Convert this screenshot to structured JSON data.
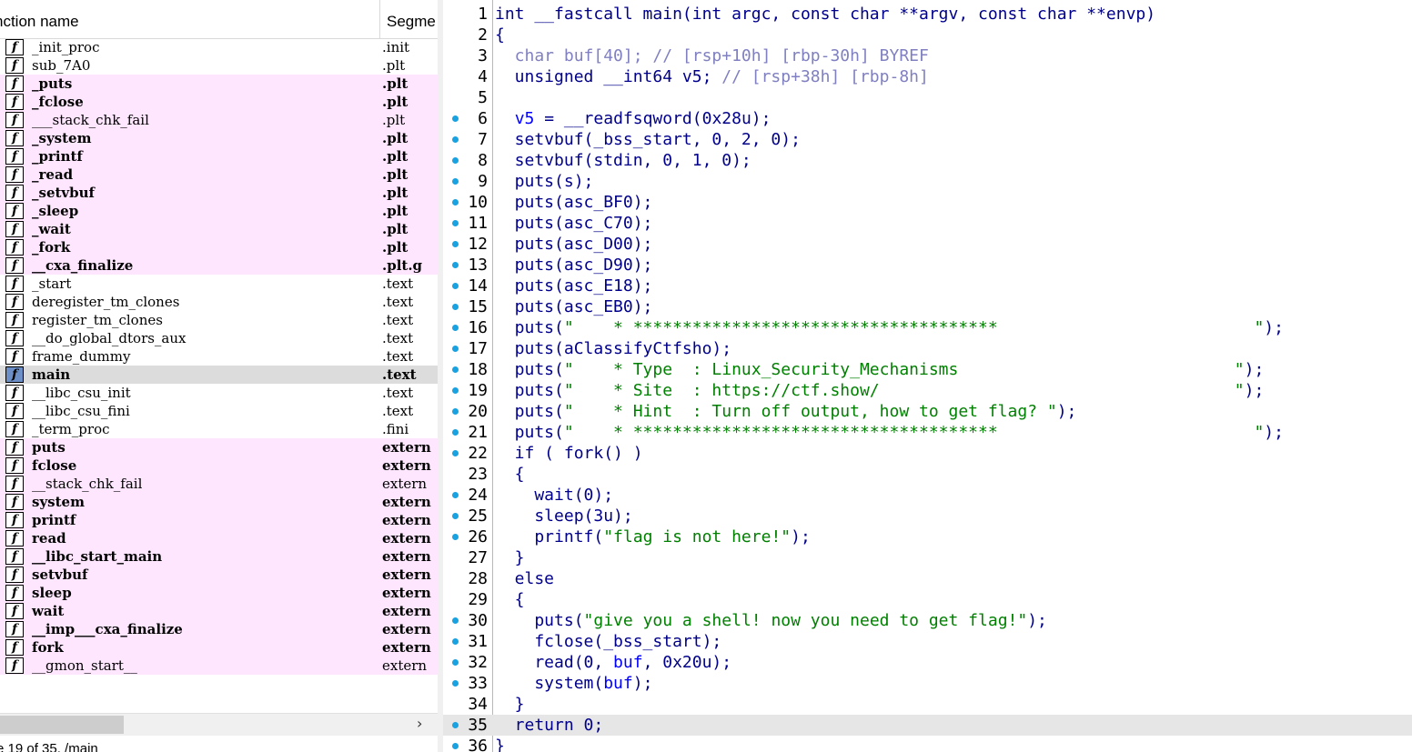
{
  "functions_panel": {
    "col_name": "nction name",
    "col_segment": "Segme",
    "status": "e 19 of 35, /main",
    "rows": [
      {
        "name": "_init_proc",
        "seg": ".init",
        "style": "normal"
      },
      {
        "name": "sub_7A0",
        "seg": ".plt",
        "style": "normal"
      },
      {
        "name": "_puts",
        "seg": ".plt",
        "style": "pink-bold"
      },
      {
        "name": "_fclose",
        "seg": ".plt",
        "style": "pink-bold"
      },
      {
        "name": "___stack_chk_fail",
        "seg": ".plt",
        "style": "pink"
      },
      {
        "name": "_system",
        "seg": ".plt",
        "style": "pink-bold"
      },
      {
        "name": "_printf",
        "seg": ".plt",
        "style": "pink-bold"
      },
      {
        "name": "_read",
        "seg": ".plt",
        "style": "pink-bold"
      },
      {
        "name": "_setvbuf",
        "seg": ".plt",
        "style": "pink-bold"
      },
      {
        "name": "_sleep",
        "seg": ".plt",
        "style": "pink-bold"
      },
      {
        "name": "_wait",
        "seg": ".plt",
        "style": "pink-bold"
      },
      {
        "name": "_fork",
        "seg": ".plt",
        "style": "pink-bold"
      },
      {
        "name": "__cxa_finalize",
        "seg": ".plt.g",
        "style": "pink-bold"
      },
      {
        "name": "_start",
        "seg": ".text",
        "style": "normal"
      },
      {
        "name": "deregister_tm_clones",
        "seg": ".text",
        "style": "normal"
      },
      {
        "name": "register_tm_clones",
        "seg": ".text",
        "style": "normal"
      },
      {
        "name": "__do_global_dtors_aux",
        "seg": ".text",
        "style": "normal"
      },
      {
        "name": "frame_dummy",
        "seg": ".text",
        "style": "normal"
      },
      {
        "name": "main",
        "seg": ".text",
        "style": "selected"
      },
      {
        "name": "__libc_csu_init",
        "seg": ".text",
        "style": "normal"
      },
      {
        "name": "__libc_csu_fini",
        "seg": ".text",
        "style": "normal"
      },
      {
        "name": "_term_proc",
        "seg": ".fini",
        "style": "normal"
      },
      {
        "name": "puts",
        "seg": "extern",
        "style": "pink-bold"
      },
      {
        "name": "fclose",
        "seg": "extern",
        "style": "pink-bold"
      },
      {
        "name": "__stack_chk_fail",
        "seg": "extern",
        "style": "pink"
      },
      {
        "name": "system",
        "seg": "extern",
        "style": "pink-bold"
      },
      {
        "name": "printf",
        "seg": "extern",
        "style": "pink-bold"
      },
      {
        "name": "read",
        "seg": "extern",
        "style": "pink-bold"
      },
      {
        "name": "__libc_start_main",
        "seg": "extern",
        "style": "pink-bold"
      },
      {
        "name": "setvbuf",
        "seg": "extern",
        "style": "pink-bold"
      },
      {
        "name": "sleep",
        "seg": "extern",
        "style": "pink-bold"
      },
      {
        "name": "wait",
        "seg": "extern",
        "style": "pink-bold"
      },
      {
        "name": "__imp___cxa_finalize",
        "seg": "extern",
        "style": "pink-bold"
      },
      {
        "name": "fork",
        "seg": "extern",
        "style": "pink-bold"
      },
      {
        "name": "__gmon_start__",
        "seg": "extern",
        "style": "pink"
      }
    ]
  },
  "code_panel": {
    "colors": {
      "keyword": "#00008b",
      "string": "#008000",
      "comment": "#8080c0",
      "dot": "#1aa1e0",
      "highlight": "#e6e6e6"
    },
    "lines": [
      {
        "n": "1",
        "dot": false,
        "hl": false,
        "segs": [
          [
            "k",
            "int __fastcall main(int argc, const char **argv, const char **envp)"
          ]
        ]
      },
      {
        "n": "2",
        "dot": false,
        "hl": false,
        "segs": [
          [
            "k",
            "{"
          ]
        ]
      },
      {
        "n": "3",
        "dot": false,
        "hl": false,
        "segs": [
          [
            "g",
            "  char buf[40]; // [rsp+10h] [rbp-30h] BYREF"
          ]
        ]
      },
      {
        "n": "4",
        "dot": false,
        "hl": false,
        "segs": [
          [
            "k",
            "  unsigned __int64 v5; "
          ],
          [
            "g",
            "// [rsp+38h] [rbp-8h]"
          ]
        ]
      },
      {
        "n": "5",
        "dot": false,
        "hl": false,
        "segs": [
          [
            "k",
            ""
          ]
        ]
      },
      {
        "n": "6",
        "dot": true,
        "hl": false,
        "segs": [
          [
            "k",
            "  "
          ],
          [
            "bl",
            "v5"
          ],
          [
            "k",
            " = __readfsqword(0x28u);"
          ]
        ]
      },
      {
        "n": "7",
        "dot": true,
        "hl": false,
        "segs": [
          [
            "k",
            "  setvbuf(_bss_start, 0, 2, 0);"
          ]
        ]
      },
      {
        "n": "8",
        "dot": true,
        "hl": false,
        "segs": [
          [
            "k",
            "  setvbuf(stdin, 0, 1, 0);"
          ]
        ]
      },
      {
        "n": "9",
        "dot": true,
        "hl": false,
        "segs": [
          [
            "k",
            "  puts(s);"
          ]
        ]
      },
      {
        "n": "10",
        "dot": true,
        "hl": false,
        "segs": [
          [
            "k",
            "  puts(asc_BF0);"
          ]
        ]
      },
      {
        "n": "11",
        "dot": true,
        "hl": false,
        "segs": [
          [
            "k",
            "  puts(asc_C70);"
          ]
        ]
      },
      {
        "n": "12",
        "dot": true,
        "hl": false,
        "segs": [
          [
            "k",
            "  puts(asc_D00);"
          ]
        ]
      },
      {
        "n": "13",
        "dot": true,
        "hl": false,
        "segs": [
          [
            "k",
            "  puts(asc_D90);"
          ]
        ]
      },
      {
        "n": "14",
        "dot": true,
        "hl": false,
        "segs": [
          [
            "k",
            "  puts(asc_E18);"
          ]
        ]
      },
      {
        "n": "15",
        "dot": true,
        "hl": false,
        "segs": [
          [
            "k",
            "  puts(asc_EB0);"
          ]
        ]
      },
      {
        "n": "16",
        "dot": true,
        "hl": false,
        "segs": [
          [
            "k",
            "  puts("
          ],
          [
            "s",
            "\"    * *************************************                          \""
          ],
          [
            "k",
            ");"
          ]
        ]
      },
      {
        "n": "17",
        "dot": true,
        "hl": false,
        "segs": [
          [
            "k",
            "  puts(aClassifyCtfsho);"
          ]
        ]
      },
      {
        "n": "18",
        "dot": true,
        "hl": false,
        "segs": [
          [
            "k",
            "  puts("
          ],
          [
            "s",
            "\"    * Type  : Linux_Security_Mechanisms                            \""
          ],
          [
            "k",
            ");"
          ]
        ]
      },
      {
        "n": "19",
        "dot": true,
        "hl": false,
        "segs": [
          [
            "k",
            "  puts("
          ],
          [
            "s",
            "\"    * Site  : https://ctf.show/                                    \""
          ],
          [
            "k",
            ");"
          ]
        ]
      },
      {
        "n": "20",
        "dot": true,
        "hl": false,
        "segs": [
          [
            "k",
            "  puts("
          ],
          [
            "s",
            "\"    * Hint  : Turn off output, how to get flag? \""
          ],
          [
            "k",
            ");"
          ]
        ]
      },
      {
        "n": "21",
        "dot": true,
        "hl": false,
        "segs": [
          [
            "k",
            "  puts("
          ],
          [
            "s",
            "\"    * *************************************                          \""
          ],
          [
            "k",
            ");"
          ]
        ]
      },
      {
        "n": "22",
        "dot": true,
        "hl": false,
        "segs": [
          [
            "k",
            "  if ( fork() )"
          ]
        ]
      },
      {
        "n": "23",
        "dot": false,
        "hl": false,
        "segs": [
          [
            "k",
            "  {"
          ]
        ]
      },
      {
        "n": "24",
        "dot": true,
        "hl": false,
        "segs": [
          [
            "k",
            "    wait(0);"
          ]
        ]
      },
      {
        "n": "25",
        "dot": true,
        "hl": false,
        "segs": [
          [
            "k",
            "    sleep(3u);"
          ]
        ]
      },
      {
        "n": "26",
        "dot": true,
        "hl": false,
        "segs": [
          [
            "k",
            "    printf("
          ],
          [
            "s",
            "\"flag is not here!\""
          ],
          [
            "k",
            ");"
          ]
        ]
      },
      {
        "n": "27",
        "dot": false,
        "hl": false,
        "segs": [
          [
            "k",
            "  }"
          ]
        ]
      },
      {
        "n": "28",
        "dot": false,
        "hl": false,
        "segs": [
          [
            "k",
            "  else"
          ]
        ]
      },
      {
        "n": "29",
        "dot": false,
        "hl": false,
        "segs": [
          [
            "k",
            "  {"
          ]
        ]
      },
      {
        "n": "30",
        "dot": true,
        "hl": false,
        "segs": [
          [
            "k",
            "    puts("
          ],
          [
            "s",
            "\"give you a shell! now you need to get flag!\""
          ],
          [
            "k",
            ");"
          ]
        ]
      },
      {
        "n": "31",
        "dot": true,
        "hl": false,
        "segs": [
          [
            "k",
            "    fclose(_bss_start);"
          ]
        ]
      },
      {
        "n": "32",
        "dot": true,
        "hl": false,
        "segs": [
          [
            "k",
            "    read(0, "
          ],
          [
            "bl",
            "buf"
          ],
          [
            "k",
            ", 0x20u);"
          ]
        ]
      },
      {
        "n": "33",
        "dot": true,
        "hl": false,
        "segs": [
          [
            "k",
            "    system("
          ],
          [
            "bl",
            "buf"
          ],
          [
            "k",
            ");"
          ]
        ]
      },
      {
        "n": "34",
        "dot": false,
        "hl": false,
        "segs": [
          [
            "k",
            "  }"
          ]
        ]
      },
      {
        "n": "35",
        "dot": true,
        "hl": true,
        "segs": [
          [
            "k",
            "  return 0;"
          ]
        ]
      },
      {
        "n": "36",
        "dot": true,
        "hl": false,
        "segs": [
          [
            "k",
            "}"
          ]
        ]
      }
    ]
  }
}
